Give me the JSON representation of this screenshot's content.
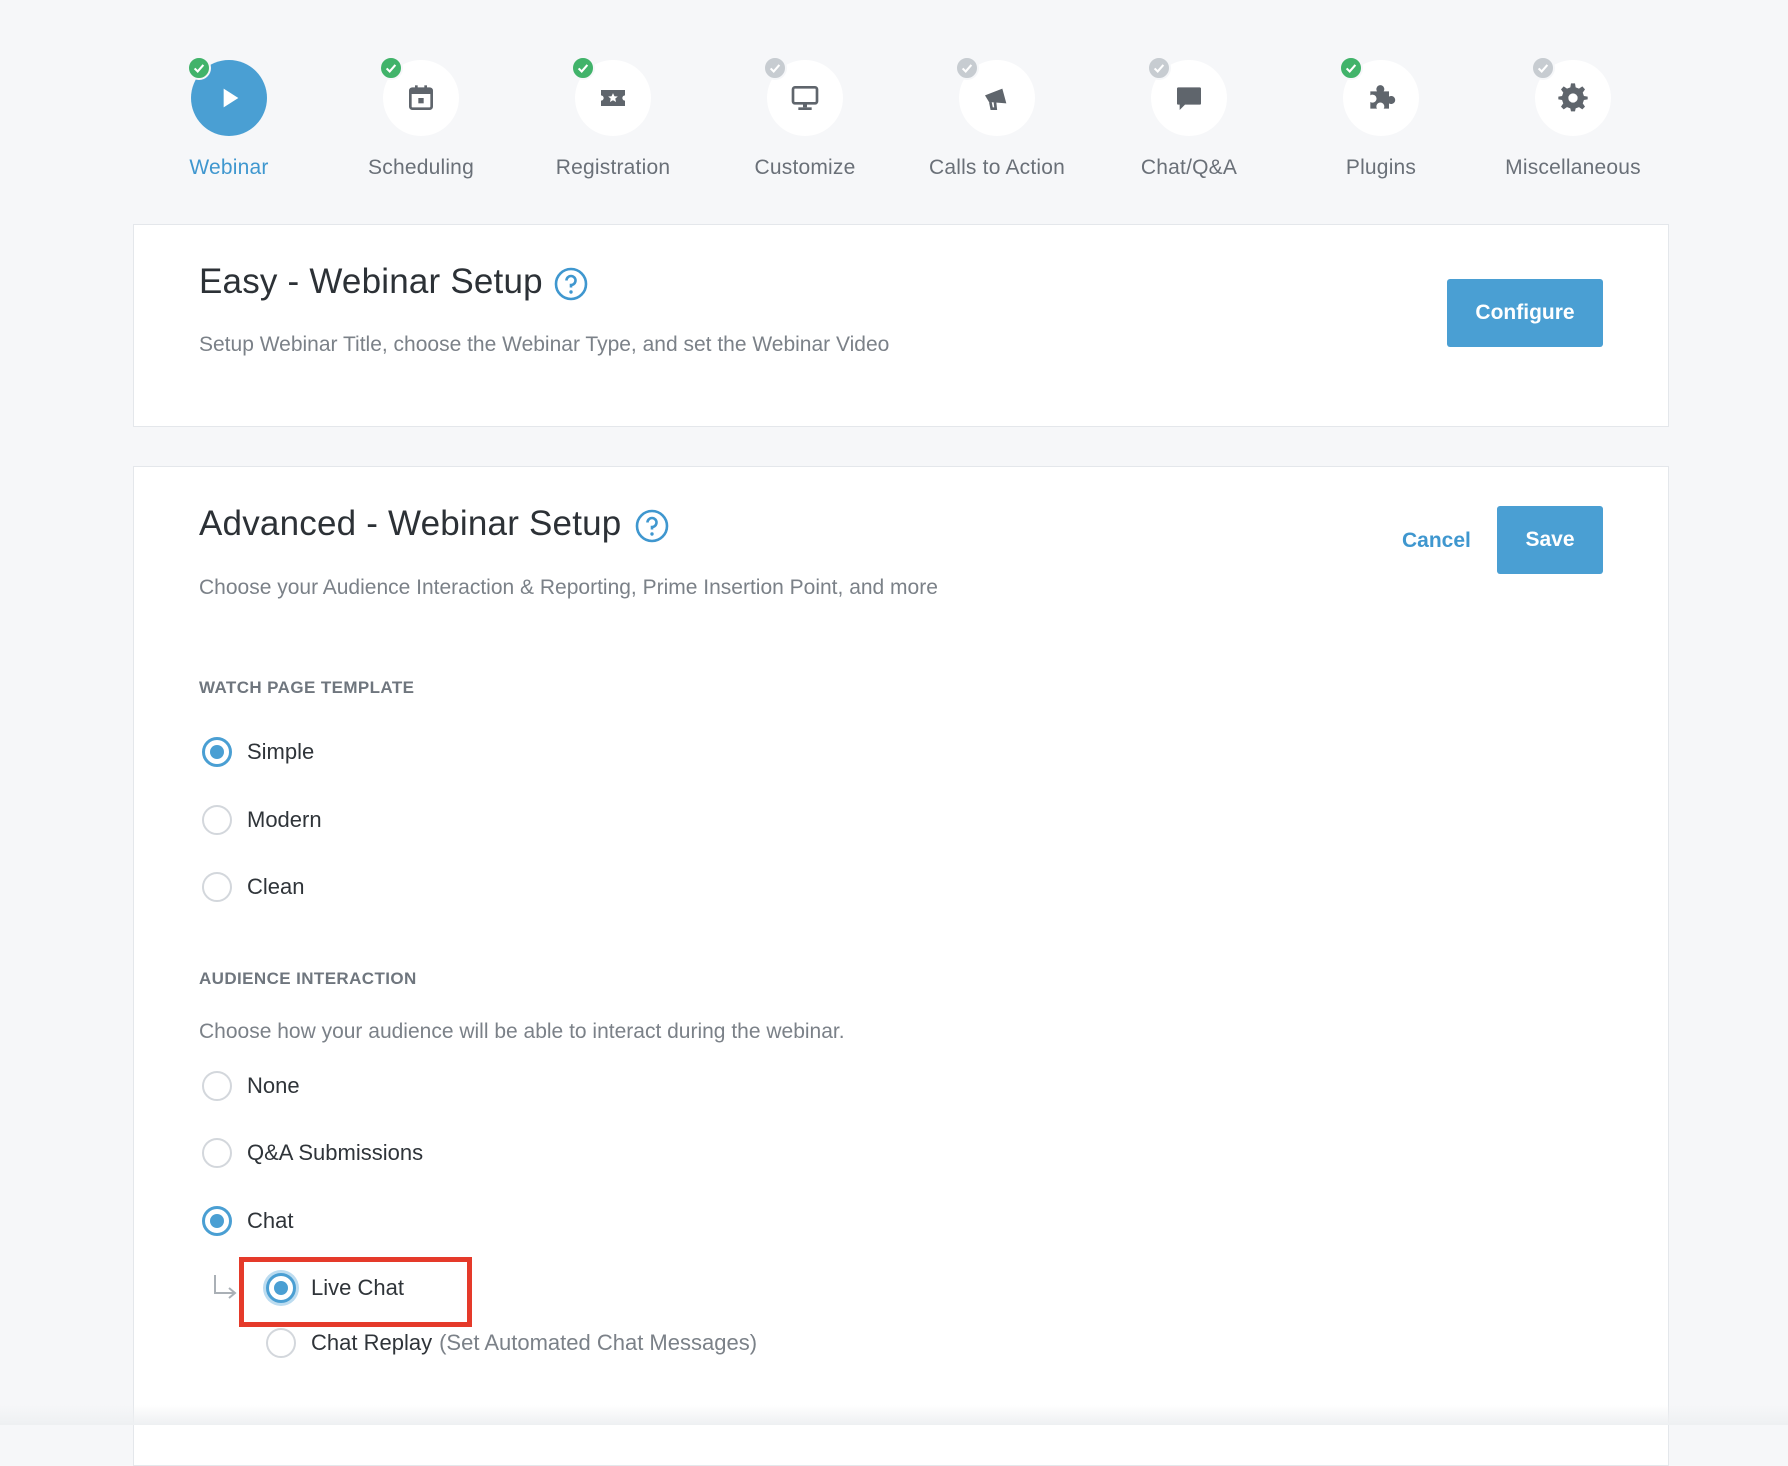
{
  "steps": [
    {
      "label": "Webinar",
      "icon": "play-icon",
      "status": "complete",
      "active": true
    },
    {
      "label": "Scheduling",
      "icon": "calendar-icon",
      "status": "complete",
      "active": false
    },
    {
      "label": "Registration",
      "icon": "ticket-icon",
      "status": "complete",
      "active": false
    },
    {
      "label": "Customize",
      "icon": "monitor-icon",
      "status": "incomplete",
      "active": false
    },
    {
      "label": "Calls to Action",
      "icon": "megaphone-icon",
      "status": "incomplete",
      "active": false
    },
    {
      "label": "Chat/Q&A",
      "icon": "chat-bubble-icon",
      "status": "incomplete",
      "active": false
    },
    {
      "label": "Plugins",
      "icon": "puzzle-icon",
      "status": "complete",
      "active": false
    },
    {
      "label": "Miscellaneous",
      "icon": "gear-icon",
      "status": "incomplete",
      "active": false
    }
  ],
  "easy": {
    "title": "Easy - Webinar Setup",
    "description": "Setup Webinar Title, choose the Webinar Type, and set the Webinar Video",
    "configure_label": "Configure"
  },
  "advanced": {
    "title": "Advanced - Webinar Setup",
    "description": "Choose your Audience Interaction & Reporting, Prime Insertion Point, and more",
    "cancel_label": "Cancel",
    "save_label": "Save",
    "watch_template": {
      "heading": "WATCH PAGE TEMPLATE",
      "options": [
        "Simple",
        "Modern",
        "Clean"
      ],
      "selected": "Simple"
    },
    "audience": {
      "heading": "AUDIENCE INTERACTION",
      "description": "Choose how your audience will be able to interact during the webinar.",
      "options": [
        "None",
        "Q&A Submissions",
        "Chat"
      ],
      "selected": "Chat",
      "chat_mode": {
        "options": [
          {
            "label": "Live Chat",
            "hint": ""
          },
          {
            "label": "Chat Replay",
            "hint": "(Set Automated Chat Messages)"
          }
        ],
        "selected": "Live Chat"
      }
    }
  },
  "colors": {
    "accent": "#4a9fd3",
    "complete": "#41b36a",
    "incomplete": "#c7ccd1",
    "highlight": "#e53a2a"
  }
}
